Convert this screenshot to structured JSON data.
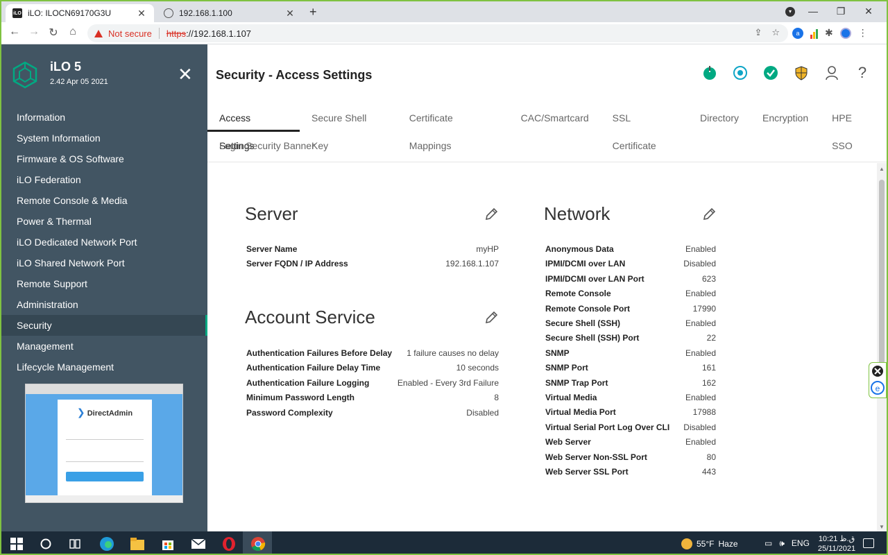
{
  "browser": {
    "tabs": [
      {
        "title": "iLO: ILOCN69170G3U",
        "favicon": "iLO",
        "close": "✕"
      },
      {
        "title": "192.168.1.100",
        "favicon": "",
        "close": "✕"
      }
    ],
    "new_tab": "+",
    "window_controls": {
      "minimize": "—",
      "restore": "❐",
      "close": "✕"
    },
    "nav": {
      "back": "←",
      "forward": "→",
      "reload": "↻",
      "home": "⌂"
    },
    "address": {
      "security_label": "Not secure",
      "scheme": "https",
      "rest": "://192.168.1.107"
    },
    "omni_icons": {
      "share": "⇪",
      "star": "☆"
    },
    "extensions": {
      "ext1": "a",
      "ext3": "✱"
    }
  },
  "sidebar": {
    "product": "iLO 5",
    "version": "2.42 Apr 05 2021",
    "close": "✕",
    "items": [
      {
        "label": "Information"
      },
      {
        "label": "System Information"
      },
      {
        "label": "Firmware & OS Software"
      },
      {
        "label": "iLO Federation"
      },
      {
        "label": "Remote Console & Media"
      },
      {
        "label": "Power & Thermal"
      },
      {
        "label": "iLO Dedicated Network Port"
      },
      {
        "label": "iLO Shared Network Port"
      },
      {
        "label": "Remote Support"
      },
      {
        "label": "Administration"
      },
      {
        "label": "Security"
      },
      {
        "label": "Management"
      },
      {
        "label": "Lifecycle Management"
      }
    ],
    "selected": "Security",
    "console_thumb": {
      "brand": "DirectAdmin"
    }
  },
  "header": {
    "title": "Security - Access Settings",
    "status_icons": [
      "power-icon",
      "uid-icon",
      "health-ok-icon",
      "security-shield-icon",
      "user-icon",
      "help-icon"
    ],
    "help": "?"
  },
  "tabs": {
    "row1": [
      {
        "label": "Access Settings"
      },
      {
        "label": "Secure Shell Key"
      },
      {
        "label": "Certificate Mappings"
      },
      {
        "label": "CAC/Smartcard"
      },
      {
        "label": "SSL Certificate"
      },
      {
        "label": "Directory"
      },
      {
        "label": "Encryption"
      },
      {
        "label": "HPE SSO"
      }
    ],
    "row2": [
      {
        "label": "Login Security Banner"
      }
    ],
    "active": "Access Settings"
  },
  "server": {
    "title": "Server",
    "rows": [
      {
        "key": "Server Name",
        "value": "myHP"
      },
      {
        "key": "Server FQDN / IP Address",
        "value": "192.168.1.107"
      }
    ]
  },
  "account": {
    "title": "Account Service",
    "rows": [
      {
        "key": "Authentication Failures Before Delay",
        "value": "1 failure causes no delay"
      },
      {
        "key": "Authentication Failure Delay Time",
        "value": "10 seconds"
      },
      {
        "key": "Authentication Failure Logging",
        "value": "Enabled - Every 3rd Failure"
      },
      {
        "key": "Minimum Password Length",
        "value": "8"
      },
      {
        "key": "Password Complexity",
        "value": "Disabled"
      }
    ]
  },
  "network": {
    "title": "Network",
    "rows": [
      {
        "key": "Anonymous Data",
        "value": "Enabled"
      },
      {
        "key": "IPMI/DCMI over LAN",
        "value": "Disabled"
      },
      {
        "key": "IPMI/DCMI over LAN Port",
        "value": "623"
      },
      {
        "key": "Remote Console",
        "value": "Enabled"
      },
      {
        "key": "Remote Console Port",
        "value": "17990"
      },
      {
        "key": "Secure Shell (SSH)",
        "value": "Enabled"
      },
      {
        "key": "Secure Shell (SSH) Port",
        "value": "22"
      },
      {
        "key": "SNMP",
        "value": "Enabled"
      },
      {
        "key": "SNMP Port",
        "value": "161"
      },
      {
        "key": "SNMP Trap Port",
        "value": "162"
      },
      {
        "key": "Virtual Media",
        "value": "Enabled"
      },
      {
        "key": "Virtual Media Port",
        "value": "17988"
      },
      {
        "key": "Virtual Serial Port Log Over CLI",
        "value": "Disabled"
      },
      {
        "key": "Web Server",
        "value": "Enabled"
      },
      {
        "key": "Web Server Non-SSL Port",
        "value": "80"
      },
      {
        "key": "Web Server SSL Port",
        "value": "443"
      }
    ]
  },
  "taskbar": {
    "weather_temp": "55°F",
    "weather_desc": "Haze",
    "lang": "ENG",
    "time": "10:21 ق.ظ",
    "date": "25/11/2021"
  },
  "colors": {
    "sidebar_bg": "#425563",
    "accent_green": "#01a982",
    "uid_blue": "#0ea5c6",
    "shield_yellow": "#f0b429"
  }
}
